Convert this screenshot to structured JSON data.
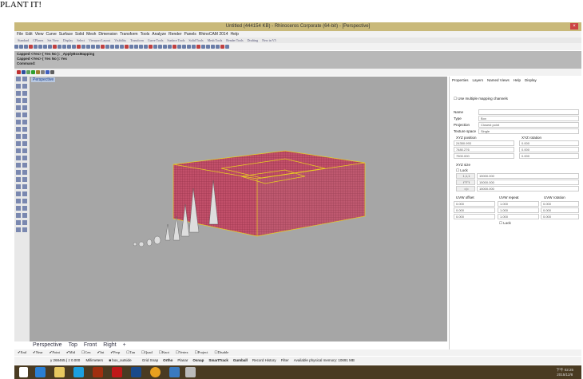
{
  "heading": "PLANT IT!",
  "window": {
    "title": "Untitled (444154 KB) - Rhinoceros Corporate (64-bit) - [Perspective]"
  },
  "menu": [
    "File",
    "Edit",
    "View",
    "Curve",
    "Surface",
    "Solid",
    "Mesh",
    "Dimension",
    "Transform",
    "Tools",
    "Analyze",
    "Render",
    "Panels",
    "RhinoCAM 2014",
    "Help"
  ],
  "toolbar_tabs": [
    "Standard",
    "CPlanes",
    "Set View",
    "Display",
    "Select",
    "Viewport Layout",
    "Visibility",
    "Transform",
    "Curve Tools",
    "Surface Tools",
    "Solid Tools",
    "Mesh Tools",
    "Render Tools",
    "Drafting",
    "New in V5"
  ],
  "command": {
    "lines": [
      "Capped <Yes> ( Yes  No ): _ApplyBoxMapping",
      "Capped <Yes> ( Yes  No ): Yes"
    ],
    "prompt": "Command:"
  },
  "viewport": {
    "label": "Perspective"
  },
  "panel": {
    "tabs": [
      "Properties",
      "Layers",
      "Named Views",
      "Help",
      "Display"
    ],
    "multi_mapping": "Use multiple mapping channels",
    "name_label": "Name",
    "name_value": "",
    "type_label": "Type",
    "type_value": "Box",
    "projection_label": "Projection",
    "projection_value": "Closest point",
    "texture_label": "Texture space",
    "texture_value": "Single",
    "xyz_position": "XYZ position",
    "xyz_rotation": "XYZ rotation",
    "positions": [
      "24350.993",
      "7480.276",
      "7500.000"
    ],
    "rotations": [
      "0.000",
      "0.000",
      "0.000"
    ],
    "xyz_size": "XYZ size",
    "lock": "Lock",
    "size_buttons": [
      "1,1,1",
      "f'''f'''f",
      "=|="
    ],
    "sizes": [
      "15000.000",
      "15000.000",
      "15000.000"
    ],
    "uvw_offset": "UVW offset",
    "uvw_repeat": "UVW repeat",
    "uvw_rotation": "UVW rotation",
    "offsets": [
      "0.000",
      "0.000",
      "0.000"
    ],
    "repeats": [
      "1.000",
      "1.000",
      "1.000"
    ],
    "uvw_rotations": [
      "0.000",
      "0.000",
      "0.000"
    ],
    "lock2": "Lock"
  },
  "view_tabs": [
    "Perspective",
    "Top",
    "Front",
    "Right",
    "+"
  ],
  "osnaps": [
    {
      "l": "End",
      "c": true
    },
    {
      "l": "Near",
      "c": true
    },
    {
      "l": "Point",
      "c": true
    },
    {
      "l": "Mid",
      "c": true
    },
    {
      "l": "Cen",
      "c": false
    },
    {
      "l": "Int",
      "c": true
    },
    {
      "l": "Perp",
      "c": true
    },
    {
      "l": "Tan",
      "c": false
    },
    {
      "l": "Quad",
      "c": false
    },
    {
      "l": "Knot",
      "c": false
    },
    {
      "l": "Vertex",
      "c": false
    },
    {
      "l": "Project",
      "c": false
    },
    {
      "l": "Disable",
      "c": false
    }
  ],
  "status": {
    "coords": "y 268465.( z 0.000",
    "units": "Millimeters",
    "layer": "box_outside",
    "items": [
      "Grid Snap",
      "Ortho",
      "Planar",
      "Osnap",
      "SmartTrack",
      "Gumball",
      "Record History",
      "Filter",
      "Available physical memory: 10691 MB"
    ]
  },
  "clock": {
    "time": "下午 02:25",
    "date": "2015/12/8"
  },
  "colors": {
    "titlebar": "#c9b97a",
    "viewport": "#a6a6a6",
    "box": "#c2506a",
    "wire": "#e8d020",
    "taskbar": "#4a3b22"
  }
}
